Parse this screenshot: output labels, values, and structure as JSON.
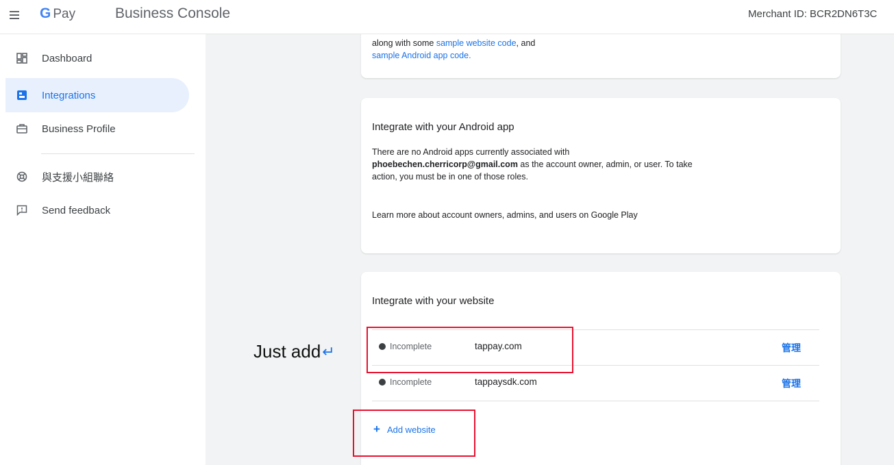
{
  "header": {
    "logo_g": "G",
    "logo_pay": "Pay",
    "title": "Business Console",
    "merchant": "Merchant ID: BCR2DN6T3C"
  },
  "sidebar": {
    "items": [
      {
        "label": "Dashboard",
        "icon": "dashboard-icon"
      },
      {
        "label": "Integrations",
        "icon": "integrations-icon",
        "active": true
      },
      {
        "label": "Business Profile",
        "icon": "briefcase-icon"
      },
      {
        "label": "與支援小組聯絡",
        "icon": "support-icon"
      },
      {
        "label": "Send feedback",
        "icon": "feedback-icon"
      }
    ]
  },
  "card_top": {
    "line1_pre": "along with some ",
    "line1_link": "sample website code",
    "line1_post": ", and",
    "line2_link": "sample Android app code."
  },
  "card_android": {
    "title": "Integrate with your Android app",
    "text_pre": "There are no Android apps currently associated with",
    "email": "phoebechen.cherricorp@gmail.com",
    "text_post": " as the account owner, admin, or user. To take",
    "text_line3": "action, you must be in one of those roles.",
    "learn_more": "Learn more about account owners, admins, and users on Google Play"
  },
  "card_website": {
    "title": "Integrate with your website",
    "rows": [
      {
        "status": "Incomplete",
        "domain": "tappay.com",
        "action": "管理"
      },
      {
        "status": "Incomplete",
        "domain": "tappaysdk.com",
        "action": "管理"
      }
    ],
    "add_label": "Add website"
  },
  "annotation": {
    "note": "Just add",
    "arrow": "↵"
  },
  "colors": {
    "accent": "#1a73e8",
    "annotation_red": "#e8102e",
    "active_bg": "#e8f0fe"
  }
}
